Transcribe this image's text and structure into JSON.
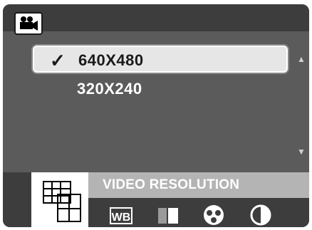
{
  "header": {
    "mode_icon": "movie-camera-icon"
  },
  "resolution_menu": {
    "options": [
      {
        "label": "640X480",
        "selected": true,
        "check": "✓"
      },
      {
        "label": "320X240",
        "selected": false,
        "check": ""
      }
    ],
    "scroll_up_icon": "triangle-up-icon",
    "scroll_down_icon": "triangle-down-icon"
  },
  "bottom_bar": {
    "title": "VIDEO RESOLUTION",
    "menu_icon": "resolution-grid-icon",
    "tools": [
      {
        "name": "white-balance-icon",
        "label": "WB"
      },
      {
        "name": "exposure-icon"
      },
      {
        "name": "color-icon"
      },
      {
        "name": "contrast-icon"
      }
    ]
  },
  "colors": {
    "background": "#5b5b5b",
    "bar": "#3d3d3d",
    "highlight": "#e6e6e6",
    "title_strip": "#b4b4b4"
  }
}
